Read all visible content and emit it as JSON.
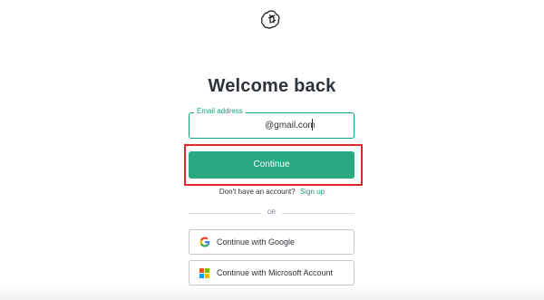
{
  "header": {
    "logo_icon": "openai-logo-icon"
  },
  "main": {
    "title": "Welcome back",
    "email": {
      "label": "Email address",
      "value": "@gmail.com"
    },
    "continue_label": "Continue",
    "signup": {
      "prompt": "Don't have an account?",
      "link": "Sign up"
    },
    "divider_label": "OR",
    "social": {
      "google_label": "Continue with Google",
      "google_icon": "google-icon",
      "microsoft_label": "Continue with Microsoft Account",
      "microsoft_icon": "microsoft-icon"
    }
  },
  "colors": {
    "accent": "#10a37f",
    "button": "#2aa881",
    "highlight": "#e0262a"
  }
}
